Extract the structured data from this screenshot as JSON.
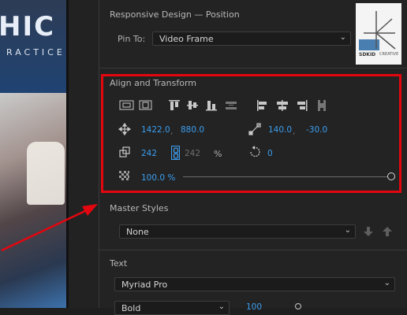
{
  "preview": {
    "brand_text": "HIC",
    "sub_text": "RACTICE"
  },
  "responsive": {
    "title": "Responsive Design — Position",
    "pin_label": "Pin To:",
    "pin_value": "Video Frame",
    "logo_text": "SDKID",
    "logo_sub": "CREATIVE"
  },
  "align": {
    "title": "Align and Transform",
    "position_x": "1422.0",
    "position_y": "880.0",
    "comma": ",",
    "anchor_x": "140.0",
    "anchor_y": "-30.0",
    "scale_w": "242",
    "scale_h": "242",
    "percent": "%",
    "rotation": "0",
    "opacity": "100.0 %",
    "opacity_level": 1.0
  },
  "master_styles": {
    "title": "Master Styles",
    "value": "None"
  },
  "text": {
    "title": "Text",
    "font": "Myriad Pro",
    "style": "Bold",
    "size": "100"
  },
  "colors": {
    "highlight": "#e4060f",
    "accent": "#3a9ef0"
  }
}
